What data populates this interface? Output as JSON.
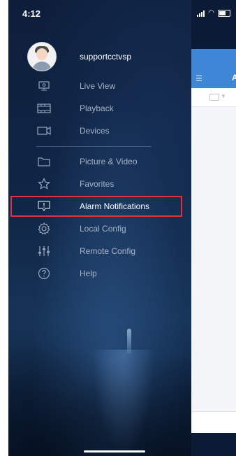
{
  "status": {
    "time": "4:12"
  },
  "user": {
    "name": "supportcctvsp"
  },
  "menu": {
    "items": [
      {
        "label": "Live View",
        "icon": "monitor-icon"
      },
      {
        "label": "Playback",
        "icon": "film-icon"
      },
      {
        "label": "Devices",
        "icon": "camera-icon"
      },
      {
        "label": "Picture & Video",
        "icon": "folder-icon"
      },
      {
        "label": "Favorites",
        "icon": "star-icon"
      },
      {
        "label": "Alarm Notifications",
        "icon": "alarm-icon",
        "selected": true
      },
      {
        "label": "Local Config",
        "icon": "gear-icon"
      },
      {
        "label": "Remote Config",
        "icon": "sliders-icon"
      },
      {
        "label": "Help",
        "icon": "help-icon"
      }
    ]
  },
  "main": {
    "header_initial": "A"
  },
  "colors": {
    "drawer_bg": "#102646",
    "header_blue": "#3f86d6",
    "highlight_red": "#e0323f"
  }
}
